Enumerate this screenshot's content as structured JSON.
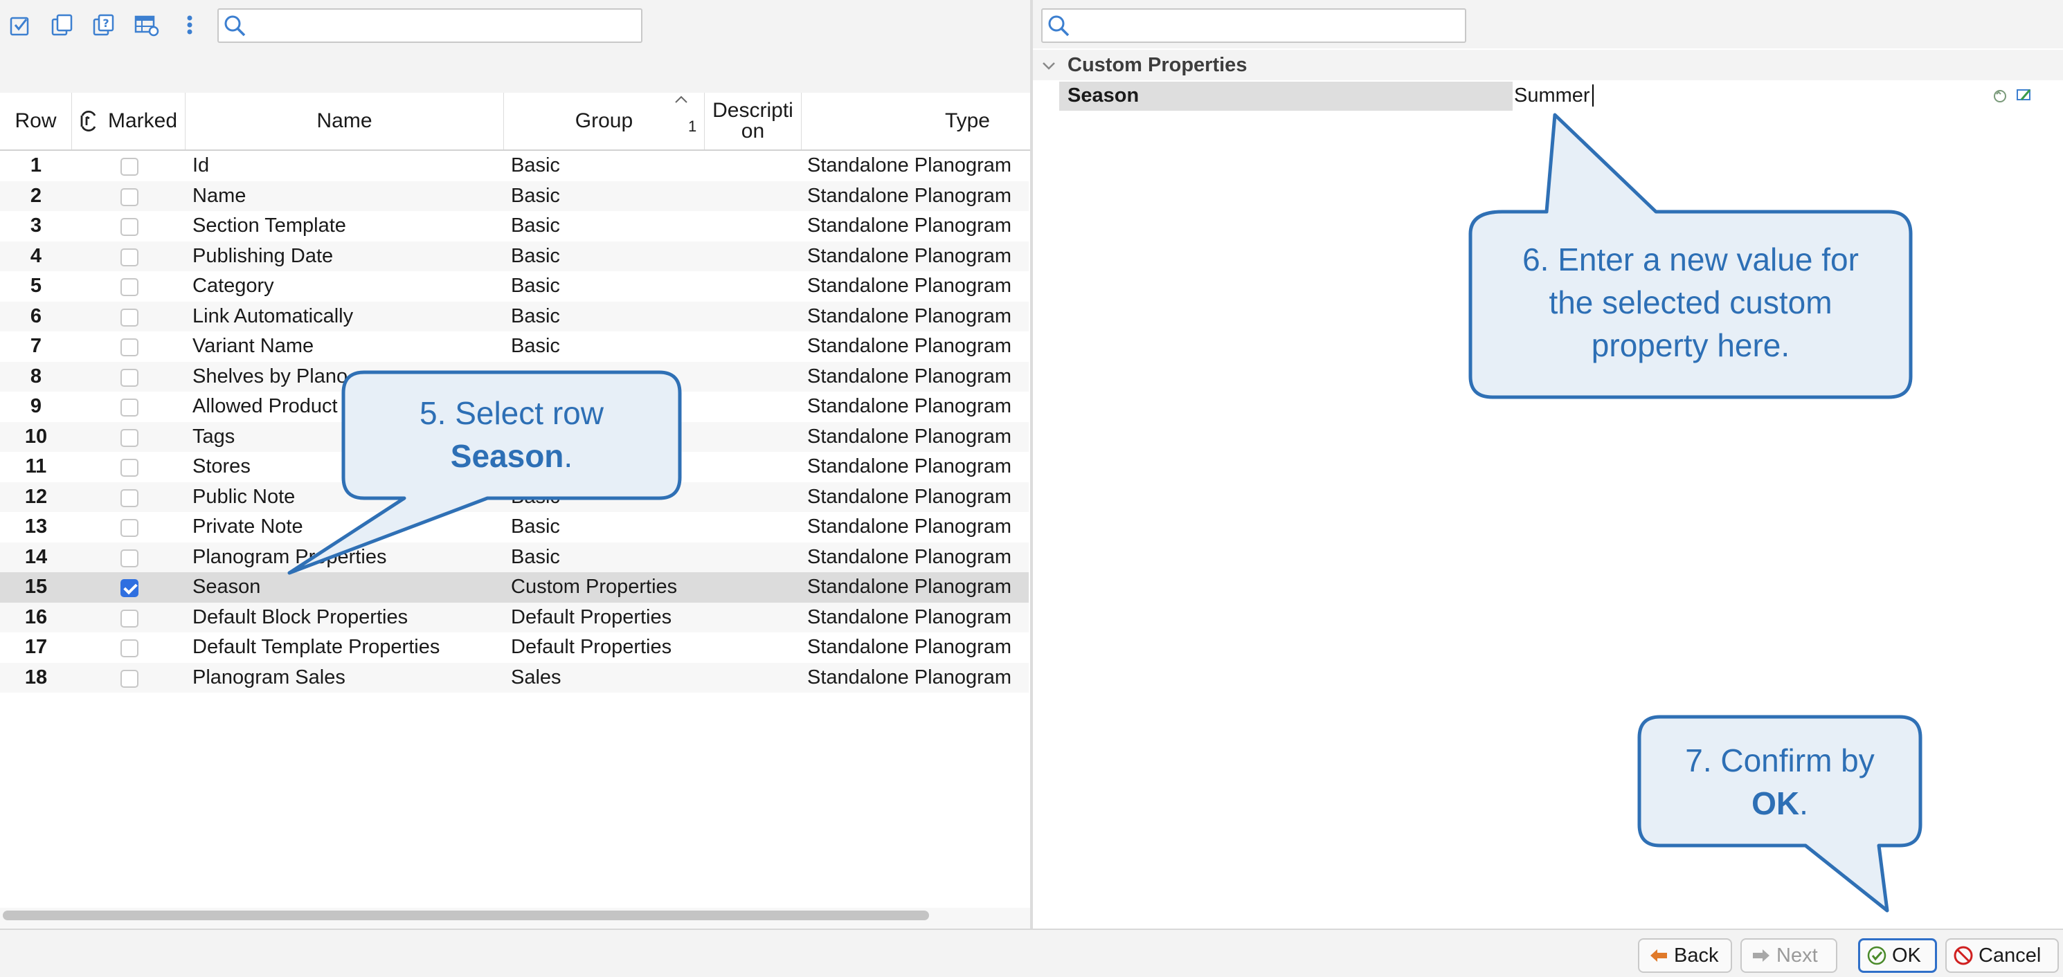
{
  "left_search": {
    "placeholder": ""
  },
  "right_search": {
    "placeholder": ""
  },
  "table": {
    "columns": {
      "row": "Row",
      "marked": "Marked",
      "name": "Name",
      "group": "Group",
      "group_sort_index": "1",
      "description": "Descripti\non",
      "type": "Type"
    },
    "rows": [
      {
        "num": "1",
        "name": "Id",
        "group": "Basic",
        "type": "Standalone Planogram",
        "checked": false
      },
      {
        "num": "2",
        "name": "Name",
        "group": "Basic",
        "type": "Standalone Planogram",
        "checked": false
      },
      {
        "num": "3",
        "name": "Section Template",
        "group": "Basic",
        "type": "Standalone Planogram",
        "checked": false
      },
      {
        "num": "4",
        "name": "Publishing Date",
        "group": "Basic",
        "type": "Standalone Planogram",
        "checked": false
      },
      {
        "num": "5",
        "name": "Category",
        "group": "Basic",
        "type": "Standalone Planogram",
        "checked": false
      },
      {
        "num": "6",
        "name": "Link Automatically",
        "group": "Basic",
        "type": "Standalone Planogram",
        "checked": false
      },
      {
        "num": "7",
        "name": "Variant Name",
        "group": "Basic",
        "type": "Standalone Planogram",
        "checked": false
      },
      {
        "num": "8",
        "name": "Shelves by Plano",
        "group": "",
        "type": "Standalone Planogram",
        "checked": false
      },
      {
        "num": "9",
        "name": "Allowed Product",
        "group": "",
        "type": "Standalone Planogram",
        "checked": false
      },
      {
        "num": "10",
        "name": "Tags",
        "group": "",
        "type": "Standalone Planogram",
        "checked": false
      },
      {
        "num": "11",
        "name": "Stores",
        "group": "",
        "type": "Standalone Planogram",
        "checked": false
      },
      {
        "num": "12",
        "name": "Public Note",
        "group": "Basic",
        "type": "Standalone Planogram",
        "checked": false
      },
      {
        "num": "13",
        "name": "Private Note",
        "group": "Basic",
        "type": "Standalone Planogram",
        "checked": false
      },
      {
        "num": "14",
        "name": "Planogram Properties",
        "group": "Basic",
        "type": "Standalone Planogram",
        "checked": false
      },
      {
        "num": "15",
        "name": "Season",
        "group": "Custom Properties",
        "type": "Standalone Planogram",
        "checked": true,
        "selected": true
      },
      {
        "num": "16",
        "name": "Default Block Properties",
        "group": "Default Properties",
        "type": "Standalone Planogram",
        "checked": false
      },
      {
        "num": "17",
        "name": "Default Template Properties",
        "group": "Default Properties",
        "type": "Standalone Planogram",
        "checked": false
      },
      {
        "num": "18",
        "name": "Planogram Sales",
        "group": "Sales",
        "type": "Standalone Planogram",
        "checked": false
      }
    ]
  },
  "properties": {
    "section_title": "Custom Properties",
    "row": {
      "name": "Season",
      "value": "Summer"
    }
  },
  "buttons": {
    "back": "Back",
    "next": "Next",
    "ok": "OK",
    "cancel": "Cancel"
  },
  "callouts": {
    "step5": {
      "prefix": "5. Select row",
      "bold": "Season",
      "suffix": "."
    },
    "step6": {
      "line1": "6. Enter a new value for",
      "line2": "the selected custom",
      "line3": "property here."
    },
    "step7": {
      "prefix": "7. Confirm by",
      "bold": "OK",
      "suffix": "."
    }
  },
  "colors": {
    "accent": "#2f6fe0",
    "callout_fill": "#e7eff7",
    "callout_stroke": "#2f70b5",
    "callout_text": "#2d6fb5",
    "selected_row": "#dcdcdc"
  },
  "icons": {
    "toolbar": [
      "mark-all-icon",
      "copy-icon",
      "help-icon",
      "table-settings-icon",
      "more-vertical-icon"
    ],
    "search": "search-icon",
    "back": "arrow-left-icon",
    "next": "arrow-right-icon",
    "ok": "check-circle-icon",
    "cancel": "prohibited-icon"
  }
}
